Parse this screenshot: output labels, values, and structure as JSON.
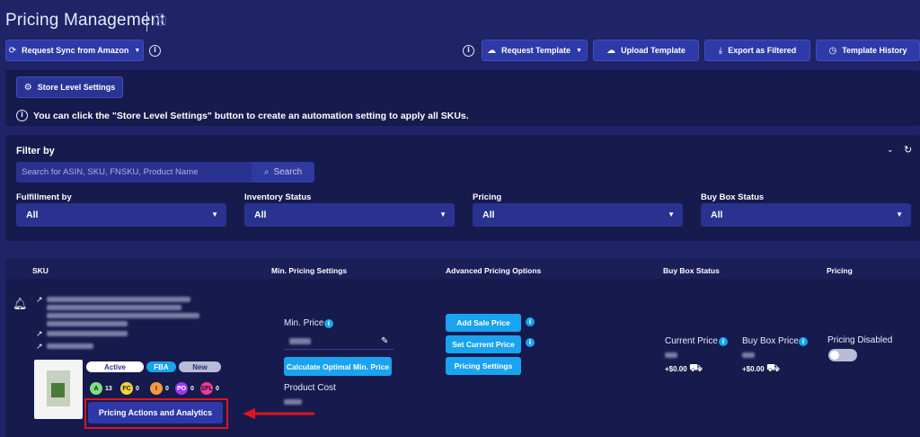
{
  "page": {
    "title": "Pricing Management"
  },
  "toolbar": {
    "request_sync_label": "Request Sync from Amazon",
    "request_template_label": "Request Template",
    "upload_template_label": "Upload Template",
    "export_label": "Export as Filtered",
    "template_history_label": "Template History"
  },
  "store": {
    "settings_label": "Store Level Settings",
    "note": "You can click the \"Store Level Settings\" button to create an automation setting to apply all SKUs."
  },
  "filter": {
    "title": "Filter by",
    "search_placeholder": "Search for ASIN, SKU, FNSKU, Product Name",
    "search_label": "Search",
    "fields": [
      {
        "label": "Fulfillment by",
        "value": "All"
      },
      {
        "label": "Inventory Status",
        "value": "All"
      },
      {
        "label": "Pricing",
        "value": "All"
      },
      {
        "label": "Buy Box Status",
        "value": "All"
      }
    ]
  },
  "table": {
    "headers": [
      "SKU",
      "Min. Pricing Settings",
      "Advanced Pricing Options",
      "Buy Box Status",
      "Pricing"
    ]
  },
  "row": {
    "status_pills": [
      "Active",
      "FBA",
      "New"
    ],
    "badges": [
      {
        "letter": "A",
        "count": "13",
        "color": "#7ee07e"
      },
      {
        "letter": "FC",
        "count": "0",
        "color": "#f4d43a"
      },
      {
        "letter": "I",
        "count": "0",
        "color": "#f59a3a"
      },
      {
        "letter": "PO",
        "count": "0",
        "color": "#9a3af0"
      },
      {
        "letter": "SPL",
        "count": "0",
        "color": "#f03a9a"
      }
    ],
    "actions_label": "Pricing Actions and Analytics",
    "min_price_label": "Min. Price",
    "calc_label": "Calculate Optimal Min. Price",
    "product_cost_label": "Product Cost",
    "add_sale_price_label": "Add Sale Price",
    "set_current_price_label": "Set Current Price",
    "pricing_settings_label": "Pricing Settings",
    "current_price_label": "Current Price",
    "buy_box_price_label": "Buy Box Price",
    "current_delta": "+$0.00",
    "buybox_delta": "+$0.00",
    "pricing_state": "Pricing Disabled"
  },
  "colors": {
    "accent": "#1aa3f0",
    "annotation": "#e0141e",
    "background": "#1f2466"
  }
}
